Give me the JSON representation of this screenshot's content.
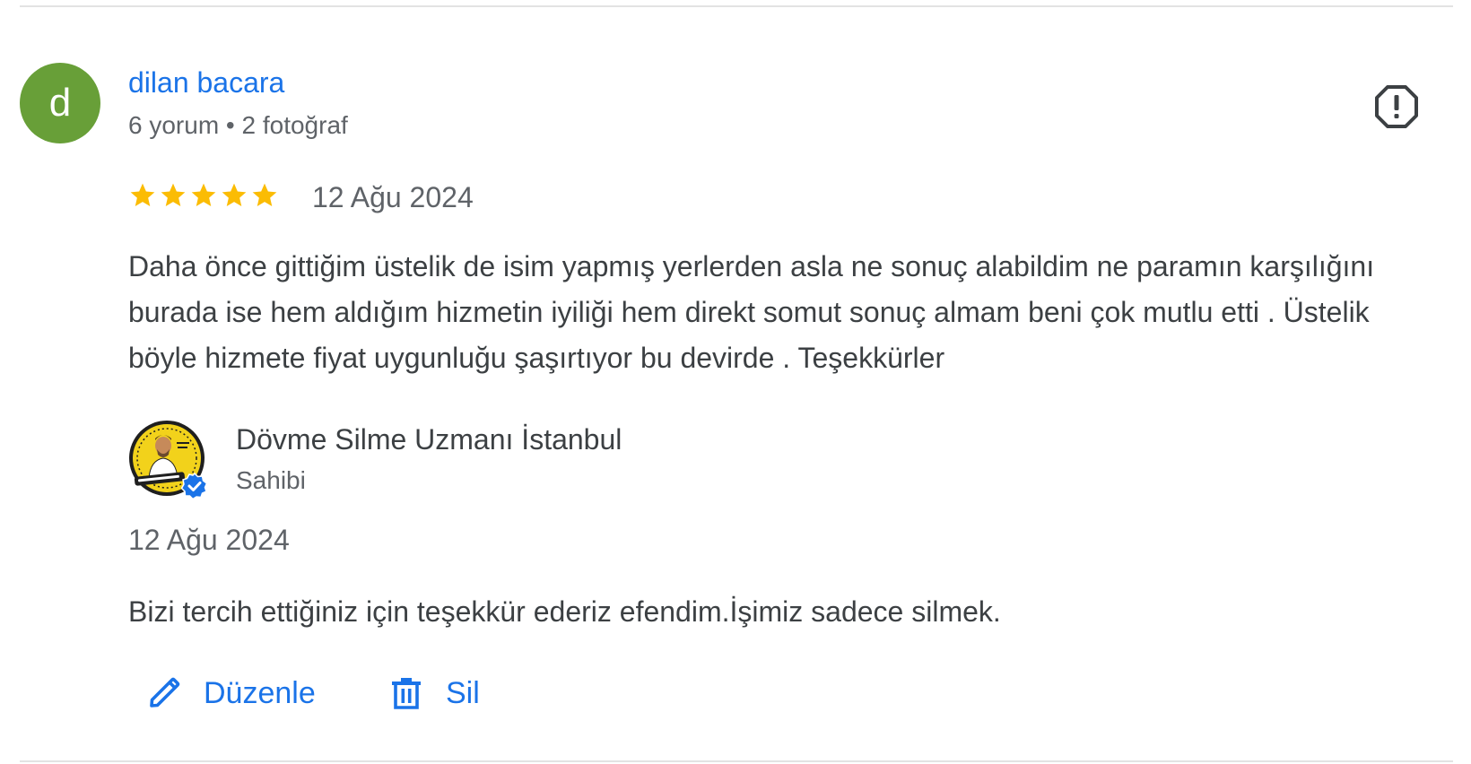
{
  "review": {
    "reviewer": {
      "initial": "d",
      "name": "dilan bacara",
      "meta": "6 yorum • 2 fotoğraf",
      "avatar_color": "#689f38"
    },
    "rating": 5,
    "rating_max": 5,
    "date": "12 Ağu 2024",
    "text": "Daha önce gittiğim üstelik de isim yapmış yerlerden asla ne sonuç alabildim ne paramın karşılığını burada ise hem aldığım hizmetin iyiliği hem direkt somut sonuç almam beni çok mutlu etti . Üstelik böyle hizmete fiyat uygunluğu şaşırtıyor bu devirde . Teşekkürler",
    "flag_icon": "report-flag-icon"
  },
  "owner_reply": {
    "name": "Dövme Silme Uzmanı İstanbul",
    "role": "Sahibi",
    "avatar_icon": "business-logo",
    "verified_icon": "verified-check-icon",
    "date": "12 Ağu 2024",
    "text": "Bizi tercih ettiğiniz için teşekkür ederiz efendim.İşimiz sadece silmek."
  },
  "actions": {
    "edit_label": "Düzenle",
    "edit_icon": "pencil-icon",
    "delete_label": "Sil",
    "delete_icon": "trash-icon"
  },
  "colors": {
    "link": "#1a73e8",
    "star": "#fbbc04",
    "text": "#3c4043",
    "secondary_text": "#5f6368",
    "divider": "#e3e3e3",
    "verified": "#1a73e8"
  }
}
